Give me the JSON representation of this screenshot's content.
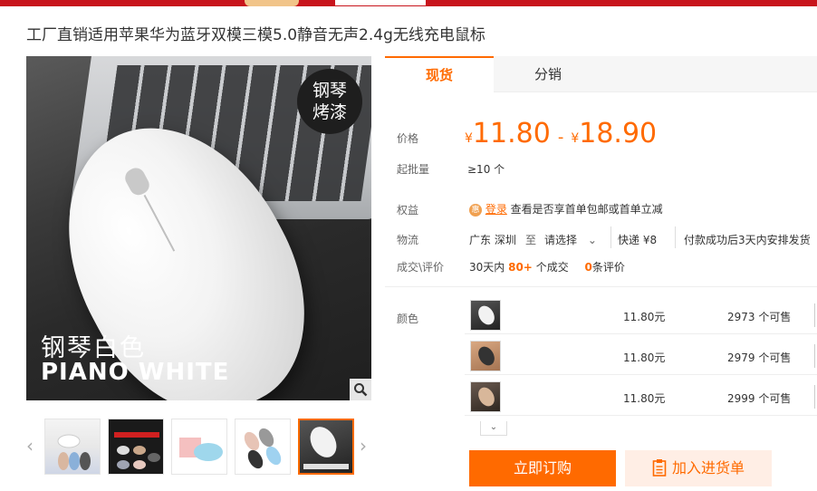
{
  "product": {
    "title": "工厂直销适用苹果华为蓝牙双模三模5.0静音无声2.4g无线充电鼠标"
  },
  "gallery": {
    "badge_line1": "钢琴",
    "badge_line2": "烤漆",
    "caption_cn": "钢琴白色",
    "caption_en": "PIANO WHITE",
    "thumbnails": [
      "thumb-1",
      "thumb-2",
      "thumb-3",
      "thumb-4",
      "thumb-5"
    ],
    "active_thumb_index": 4
  },
  "tabs": [
    {
      "label": "现货",
      "active": true
    },
    {
      "label": "分销",
      "active": false
    }
  ],
  "price": {
    "label": "价格",
    "currency": "¥",
    "low": "11.80",
    "separator": "-",
    "high": "18.90"
  },
  "moq": {
    "label": "起批量",
    "value": "≥10 个"
  },
  "benefits": {
    "label": "权益",
    "login_icon_text": "惠",
    "login_link": "登录",
    "text": "查看是否享首单包邮或首单立减"
  },
  "logistics": {
    "label": "物流",
    "from": "广东 深圳",
    "to_word": "至",
    "select": "请选择",
    "express": "快递 ¥8",
    "shipping": "付款成功后3天内安排发货"
  },
  "deals": {
    "label": "成交\\评价",
    "prefix": "30天内",
    "count": "80+",
    "unit": "个成交",
    "reviews": "0",
    "reviews_unit": "条评价"
  },
  "variants": {
    "label": "颜色",
    "items": [
      {
        "price": "11.80元",
        "stock": "2973 个可售"
      },
      {
        "price": "11.80元",
        "stock": "2979 个可售"
      },
      {
        "price": "11.80元",
        "stock": "2999 个可售"
      }
    ]
  },
  "actions": {
    "buy": "立即订购",
    "cart": "加入进货单"
  },
  "colors": {
    "accent": "#ff6a00",
    "topbar": "#c8141c"
  }
}
